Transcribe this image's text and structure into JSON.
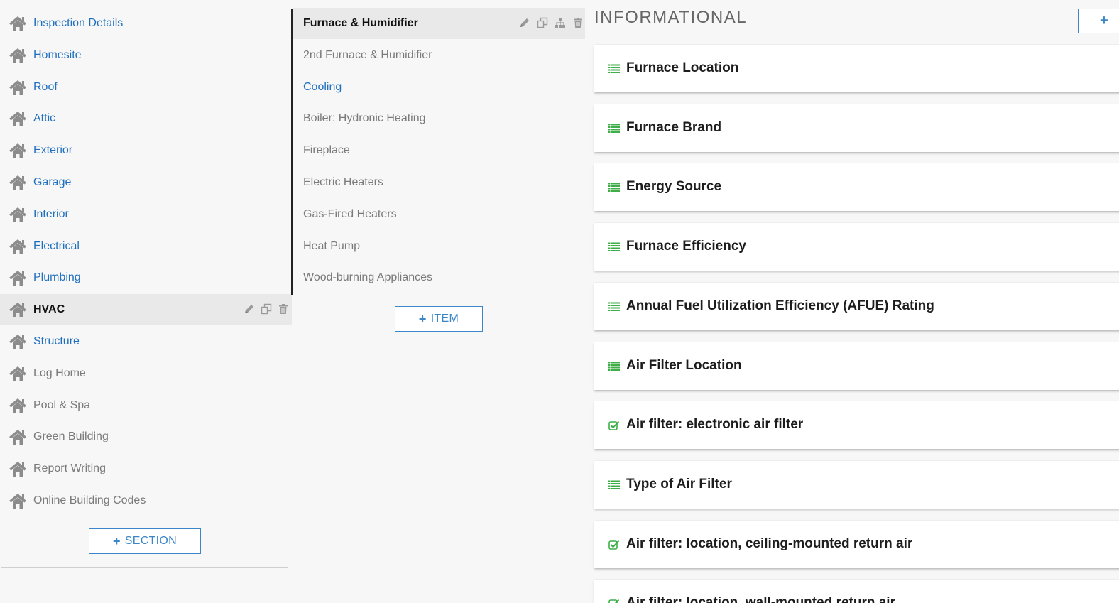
{
  "sections": {
    "items": [
      {
        "label": "Inspection Details",
        "style": "link"
      },
      {
        "label": "Homesite",
        "style": "link"
      },
      {
        "label": "Roof",
        "style": "link"
      },
      {
        "label": "Attic",
        "style": "link"
      },
      {
        "label": "Exterior",
        "style": "link"
      },
      {
        "label": "Garage",
        "style": "link"
      },
      {
        "label": "Interior",
        "style": "link"
      },
      {
        "label": "Electrical",
        "style": "link"
      },
      {
        "label": "Plumbing",
        "style": "link"
      },
      {
        "label": "HVAC",
        "style": "active"
      },
      {
        "label": "Structure",
        "style": "link"
      },
      {
        "label": "Log Home",
        "style": "muted"
      },
      {
        "label": "Pool & Spa",
        "style": "muted"
      },
      {
        "label": "Green Building",
        "style": "muted"
      },
      {
        "label": "Report Writing",
        "style": "muted"
      },
      {
        "label": "Online Building Codes",
        "style": "muted"
      }
    ],
    "add_button_label": "SECTION"
  },
  "items": {
    "list": [
      {
        "label": "Furnace & Humidifier",
        "style": "active"
      },
      {
        "label": "2nd Furnace & Humidifier",
        "style": "muted"
      },
      {
        "label": "Cooling",
        "style": "link"
      },
      {
        "label": "Boiler: Hydronic Heating",
        "style": "muted"
      },
      {
        "label": "Fireplace",
        "style": "muted"
      },
      {
        "label": "Electric Heaters",
        "style": "muted"
      },
      {
        "label": "Gas-Fired Heaters",
        "style": "muted"
      },
      {
        "label": "Heat Pump",
        "style": "muted"
      },
      {
        "label": "Wood-burning Appliances",
        "style": "muted"
      }
    ],
    "add_button_label": "ITEM"
  },
  "comments": {
    "category_title": "INFORMATIONAL",
    "add_button_label": "+",
    "cards": [
      {
        "title": "Furnace Location",
        "icon": "list-icon"
      },
      {
        "title": "Furnace Brand",
        "icon": "list-icon"
      },
      {
        "title": "Energy Source",
        "icon": "list-icon"
      },
      {
        "title": "Furnace Efficiency",
        "icon": "list-icon"
      },
      {
        "title": "Annual Fuel Utilization Efficiency (AFUE) Rating",
        "icon": "list-icon"
      },
      {
        "title": "Air Filter Location",
        "icon": "list-icon"
      },
      {
        "title": "Air filter: electronic air filter",
        "icon": "check-square-icon"
      },
      {
        "title": "Type of Air Filter",
        "icon": "list-icon"
      },
      {
        "title": "Air filter: location, ceiling-mounted return air",
        "icon": "check-square-icon"
      },
      {
        "title": "Air filter: location, wall-mounted return air",
        "icon": "check-square-icon"
      }
    ]
  },
  "colors": {
    "link": "#1f6fbf",
    "muted": "#7a7a7a",
    "accent": "#3a86c8",
    "icon_green": "#3fae49",
    "home_icon": "#8c8c8c"
  }
}
